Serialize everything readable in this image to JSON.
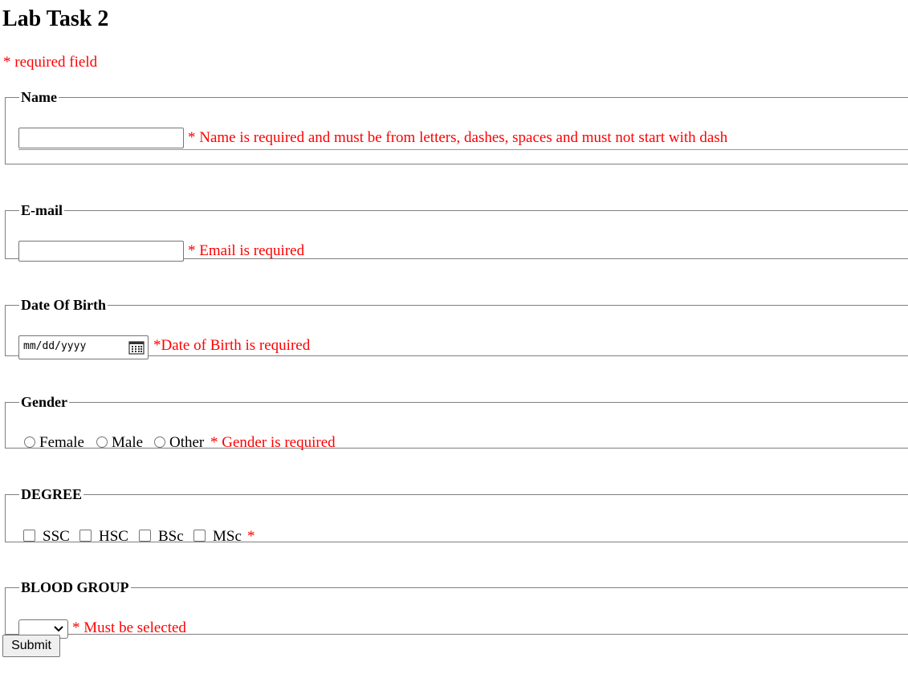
{
  "page": {
    "title": "Lab Task 2",
    "required_note": "* required field"
  },
  "name": {
    "legend": "Name",
    "value": "",
    "error": "* Name is required and must be from letters, dashes, spaces and must not start with dash"
  },
  "email": {
    "legend": "E-mail",
    "value": "",
    "error": "* Email is required"
  },
  "dob": {
    "legend": "Date Of Birth",
    "placeholder": "mm/dd/yyyy",
    "error": "*Date of Birth is required"
  },
  "gender": {
    "legend": "Gender",
    "options": [
      "Female",
      "Male",
      "Other"
    ],
    "error": "* Gender is required"
  },
  "degree": {
    "legend": "DEGREE",
    "options": [
      "SSC",
      "HSC",
      "BSc",
      "MSc"
    ],
    "error": "*"
  },
  "blood_group": {
    "legend": "BLOOD GROUP",
    "selected": "",
    "error": "* Must be selected"
  },
  "submit": {
    "label": "Submit"
  },
  "colors": {
    "error": "#ff0000",
    "border": "#7f7f7f",
    "button_bg": "#efefef"
  },
  "icons": {
    "date_picker": "calendar-icon",
    "select": "chevron-down-icon"
  }
}
